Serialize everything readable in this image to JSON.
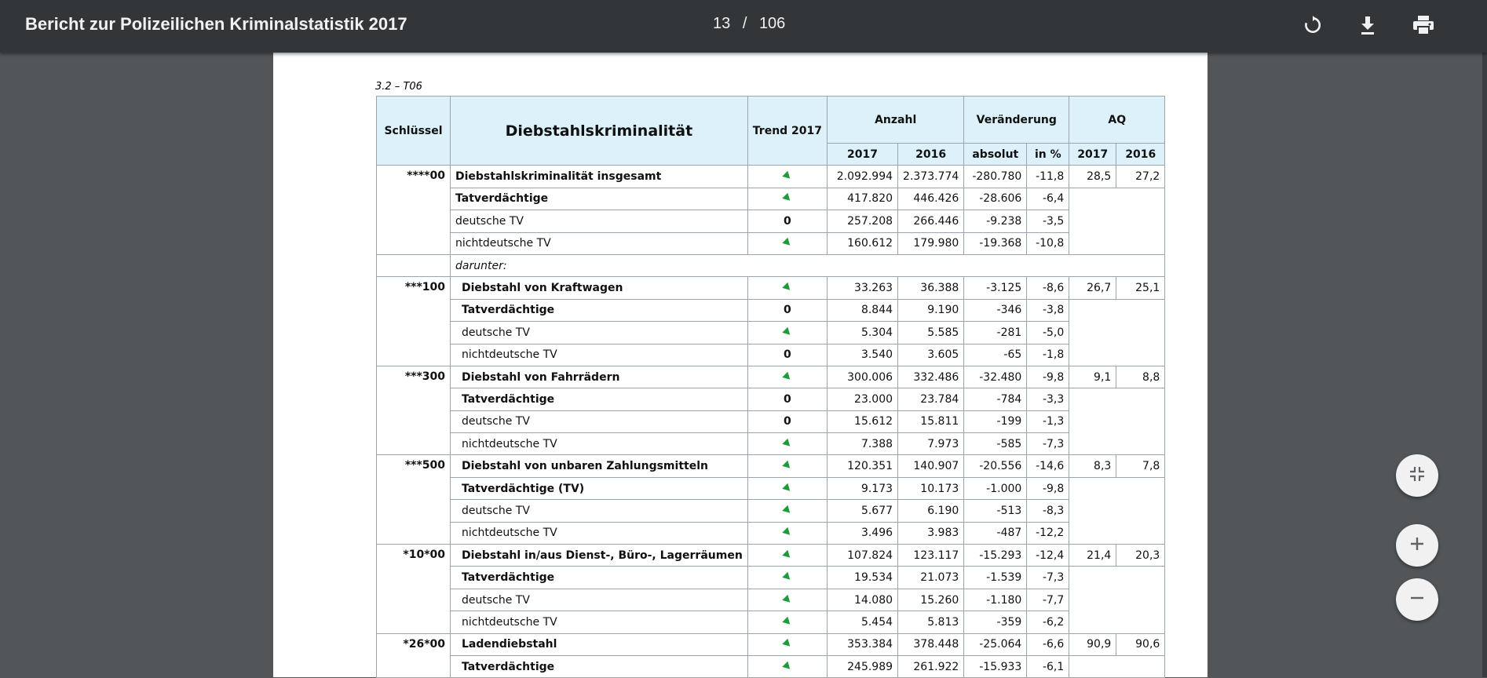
{
  "toolbar": {
    "title": "Bericht zur Polizeilichen Kriminalstatistik 2017",
    "current_page": "13",
    "separator": "/",
    "total_pages": "106",
    "icons": [
      "rotate-icon",
      "download-icon",
      "print-icon"
    ]
  },
  "doc": {
    "caption": "3.2 – T06",
    "headers": {
      "key": "Schlüssel",
      "crime": "Diebstahlskriminalität",
      "trend": "Trend 2017",
      "anzahl": "Anzahl",
      "veraenderung": "Veränderung",
      "aq": "AQ",
      "y2017": "2017",
      "y2016": "2016",
      "absolut": "absolut",
      "in_pct": "in %",
      "aq2017": "2017",
      "aq2016": "2016"
    },
    "groups": [
      {
        "key": "****00",
        "rows": [
          {
            "label": "Diebstahlskriminalität insgesamt",
            "trend": "down",
            "v2017": "2.092.994",
            "v2016": "2.373.774",
            "abs": "-280.780",
            "pct": "-11,8",
            "aq2017": "28,5",
            "aq2016": "27,2"
          },
          {
            "label": "Tatverdächtige",
            "trend": "down",
            "v2017": "417.820",
            "v2016": "446.426",
            "abs": "-28.606",
            "pct": "-6,4"
          },
          {
            "label": "deutsche TV",
            "trend": "0",
            "v2017": "257.208",
            "v2016": "266.446",
            "abs": "-9.238",
            "pct": "-3,5"
          },
          {
            "label": "nichtdeutsche TV",
            "trend": "down",
            "v2017": "160.612",
            "v2016": "179.980",
            "abs": "-19.368",
            "pct": "-10,8"
          }
        ]
      },
      {
        "key": "***100",
        "rows": [
          {
            "label": "Diebstahl von Kraftwagen",
            "trend": "down",
            "v2017": "33.263",
            "v2016": "36.388",
            "abs": "-3.125",
            "pct": "-8,6",
            "aq2017": "26,7",
            "aq2016": "25,1"
          },
          {
            "label": "Tatverdächtige",
            "trend": "0",
            "v2017": "8.844",
            "v2016": "9.190",
            "abs": "-346",
            "pct": "-3,8"
          },
          {
            "label": "deutsche TV",
            "trend": "down",
            "v2017": "5.304",
            "v2016": "5.585",
            "abs": "-281",
            "pct": "-5,0"
          },
          {
            "label": "nichtdeutsche TV",
            "trend": "0",
            "v2017": "3.540",
            "v2016": "3.605",
            "abs": "-65",
            "pct": "-1,8"
          }
        ]
      },
      {
        "key": "***300",
        "rows": [
          {
            "label": "Diebstahl von Fahrrädern",
            "trend": "down",
            "v2017": "300.006",
            "v2016": "332.486",
            "abs": "-32.480",
            "pct": "-9,8",
            "aq2017": "9,1",
            "aq2016": "8,8"
          },
          {
            "label": "Tatverdächtige",
            "trend": "0",
            "v2017": "23.000",
            "v2016": "23.784",
            "abs": "-784",
            "pct": "-3,3"
          },
          {
            "label": "deutsche TV",
            "trend": "0",
            "v2017": "15.612",
            "v2016": "15.811",
            "abs": "-199",
            "pct": "-1,3"
          },
          {
            "label": "nichtdeutsche TV",
            "trend": "down",
            "v2017": "7.388",
            "v2016": "7.973",
            "abs": "-585",
            "pct": "-7,3"
          }
        ]
      },
      {
        "key": "***500",
        "rows": [
          {
            "label": "Diebstahl von unbaren Zahlungsmitteln",
            "trend": "down",
            "v2017": "120.351",
            "v2016": "140.907",
            "abs": "-20.556",
            "pct": "-14,6",
            "aq2017": "8,3",
            "aq2016": "7,8"
          },
          {
            "label": "Tatverdächtige (TV)",
            "trend": "down",
            "v2017": "9.173",
            "v2016": "10.173",
            "abs": "-1.000",
            "pct": "-9,8"
          },
          {
            "label": "deutsche TV",
            "trend": "down",
            "v2017": "5.677",
            "v2016": "6.190",
            "abs": "-513",
            "pct": "-8,3"
          },
          {
            "label": "nichtdeutsche TV",
            "trend": "down",
            "v2017": "3.496",
            "v2016": "3.983",
            "abs": "-487",
            "pct": "-12,2"
          }
        ]
      },
      {
        "key": "*10*00",
        "rows": [
          {
            "label": "Diebstahl in/aus Dienst-, Büro-, Lagerräumen",
            "trend": "down",
            "v2017": "107.824",
            "v2016": "123.117",
            "abs": "-15.293",
            "pct": "-12,4",
            "aq2017": "21,4",
            "aq2016": "20,3"
          },
          {
            "label": "Tatverdächtige",
            "trend": "down",
            "v2017": "19.534",
            "v2016": "21.073",
            "abs": "-1.539",
            "pct": "-7,3"
          },
          {
            "label": "deutsche TV",
            "trend": "down",
            "v2017": "14.080",
            "v2016": "15.260",
            "abs": "-1.180",
            "pct": "-7,7"
          },
          {
            "label": "nichtdeutsche TV",
            "trend": "down",
            "v2017": "5.454",
            "v2016": "5.813",
            "abs": "-359",
            "pct": "-6,2"
          }
        ]
      },
      {
        "key": "*26*00",
        "rows": [
          {
            "label": "Ladendiebstahl",
            "trend": "down",
            "v2017": "353.384",
            "v2016": "378.448",
            "abs": "-25.064",
            "pct": "-6,6",
            "aq2017": "90,9",
            "aq2016": "90,6"
          },
          {
            "label": "Tatverdächtige",
            "trend": "down",
            "v2017": "245.989",
            "v2016": "261.922",
            "abs": "-15.933",
            "pct": "-6,1"
          }
        ]
      }
    ],
    "darunter": "darunter:"
  },
  "controls": {
    "icons": [
      "fit-page-icon",
      "zoom-in-icon",
      "zoom-out-icon"
    ]
  },
  "colors": {
    "toolbar_bg": "#323639",
    "viewer_bg": "#525659",
    "header_fill": "#dcf1fa",
    "trend_arrow": "#1f9a3a"
  }
}
